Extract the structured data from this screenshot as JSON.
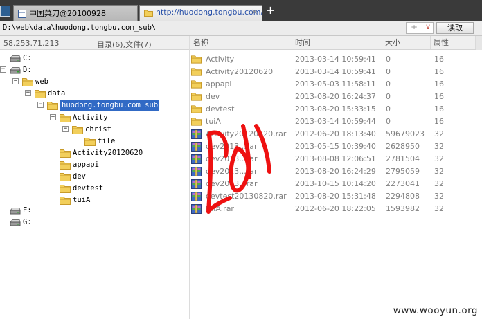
{
  "tabs": [
    {
      "label": "中国菜刀@20100928",
      "active": false
    },
    {
      "label": "http://huodong.tongbu.com/...",
      "active": true
    }
  ],
  "new_tab_label": "+",
  "path": "D:\\web\\data\\huodong.tongbu.com_sub\\",
  "combo_plus": "±",
  "read_button": "读取",
  "left": {
    "ip": "58.253.71.213",
    "counts": "目录(6),文件(7)"
  },
  "tree": [
    {
      "label": "C:",
      "kind": "drive",
      "depth": 0
    },
    {
      "label": "D:",
      "kind": "drive",
      "depth": 0,
      "expander": "−"
    },
    {
      "label": "web",
      "kind": "folder",
      "depth": 1,
      "expander": "−"
    },
    {
      "label": "data",
      "kind": "folder",
      "depth": 2,
      "expander": "−"
    },
    {
      "label": "huodong.tongbu.com_sub",
      "kind": "folder",
      "depth": 3,
      "expander": "−",
      "selected": true
    },
    {
      "label": "Activity",
      "kind": "folder",
      "depth": 4,
      "expander": "−"
    },
    {
      "label": "christ",
      "kind": "folder",
      "depth": 5,
      "expander": "−"
    },
    {
      "label": "file",
      "kind": "folder",
      "depth": 6
    },
    {
      "label": "Activity20120620",
      "kind": "folder",
      "depth": 4
    },
    {
      "label": "appapi",
      "kind": "folder",
      "depth": 4
    },
    {
      "label": "dev",
      "kind": "folder",
      "depth": 4
    },
    {
      "label": "devtest",
      "kind": "folder",
      "depth": 4
    },
    {
      "label": "tuiA",
      "kind": "folder",
      "depth": 4
    },
    {
      "label": "E:",
      "kind": "drive",
      "depth": 0
    },
    {
      "label": "G:",
      "kind": "drive",
      "depth": 0
    }
  ],
  "columns": [
    "名称",
    "时间",
    "大小",
    "属性"
  ],
  "files": [
    {
      "name": "Activity",
      "time": "2013-03-14 10:59:41",
      "size": "0",
      "attr": "16",
      "kind": "folder"
    },
    {
      "name": "Activity20120620",
      "time": "2013-03-14 10:59:41",
      "size": "0",
      "attr": "16",
      "kind": "folder"
    },
    {
      "name": "appapi",
      "time": "2013-05-03 11:58:11",
      "size": "0",
      "attr": "16",
      "kind": "folder"
    },
    {
      "name": "dev",
      "time": "2013-08-20 16:24:37",
      "size": "0",
      "attr": "16",
      "kind": "folder"
    },
    {
      "name": "devtest",
      "time": "2013-08-20 15:33:15",
      "size": "0",
      "attr": "16",
      "kind": "folder"
    },
    {
      "name": "tuiA",
      "time": "2013-03-14 10:59:44",
      "size": "0",
      "attr": "16",
      "kind": "folder"
    },
    {
      "name": "Activity20120620.rar",
      "time": "2012-06-20 18:13:40",
      "size": "59679023",
      "attr": "32",
      "kind": "rar"
    },
    {
      "name": "dev2013...rar",
      "time": "2013-05-15 10:39:40",
      "size": "2628950",
      "attr": "32",
      "kind": "rar"
    },
    {
      "name": "dev2013...rar",
      "time": "2013-08-08 12:06:51",
      "size": "2781504",
      "attr": "32",
      "kind": "rar"
    },
    {
      "name": "dev2013...rar",
      "time": "2013-08-20 16:24:29",
      "size": "2795059",
      "attr": "32",
      "kind": "rar"
    },
    {
      "name": "dev2013...rar",
      "time": "2013-10-15 10:14:20",
      "size": "2273041",
      "attr": "32",
      "kind": "rar"
    },
    {
      "name": "devtest20130820.rar",
      "time": "2013-08-20 15:31:48",
      "size": "2294808",
      "attr": "32",
      "kind": "rar"
    },
    {
      "name": "tuiA.rar",
      "time": "2012-06-20 18:22:05",
      "size": "1593982",
      "attr": "32",
      "kind": "rar"
    }
  ],
  "watermark": "www.wooyun.org",
  "colors": {
    "folder": "#f2cf5b",
    "folder_stroke": "#c89b2a",
    "selection": "#316ac5",
    "scribble": "#ee1111"
  },
  "icons": {
    "folder": "folder-icon",
    "rar": "rar-archive-icon",
    "drive": "drive-icon",
    "tab": "page-icon"
  }
}
